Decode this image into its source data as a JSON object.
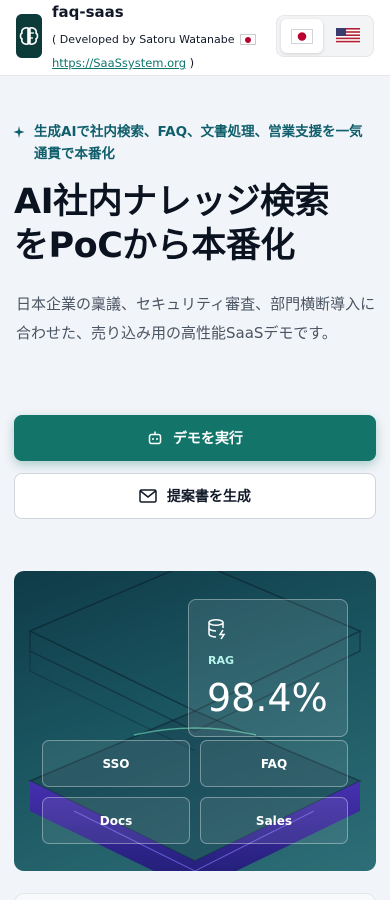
{
  "header": {
    "app_name": "faq-saas",
    "developer_prefix": "( Developed by Satoru Watanabe",
    "url": "https://SaaSsystem.org",
    "url_suffix": ")",
    "languages": [
      {
        "code": "ja",
        "icon": "japan-flag-icon",
        "active": true
      },
      {
        "code": "en",
        "icon": "us-flag-icon",
        "active": false
      }
    ]
  },
  "hero": {
    "tagline": "生成AIで社内検索、FAQ、文書処理、営業支援を一気通貫で本番化",
    "title_line1": "AI社内ナレッジ検索",
    "title_line2": "をPoCから本番化",
    "description": "日本企業の稟議、セキュリティ審査、部門横断導入に合わせた、売り込み用の高性能SaaSデモです。"
  },
  "actions": {
    "primary_label": "デモを実行",
    "primary_icon": "robot-icon",
    "secondary_label": "提案書を生成",
    "secondary_icon": "mail-icon"
  },
  "visual": {
    "metric_icon": "database-icon",
    "metric_label": "RAG",
    "metric_value": "98.4%",
    "chips": [
      "SSO",
      "FAQ",
      "Docs",
      "Sales"
    ]
  },
  "colors": {
    "primary": "#13756a",
    "tagline": "#0f5e6b",
    "visual_bg": "#1a5560"
  }
}
